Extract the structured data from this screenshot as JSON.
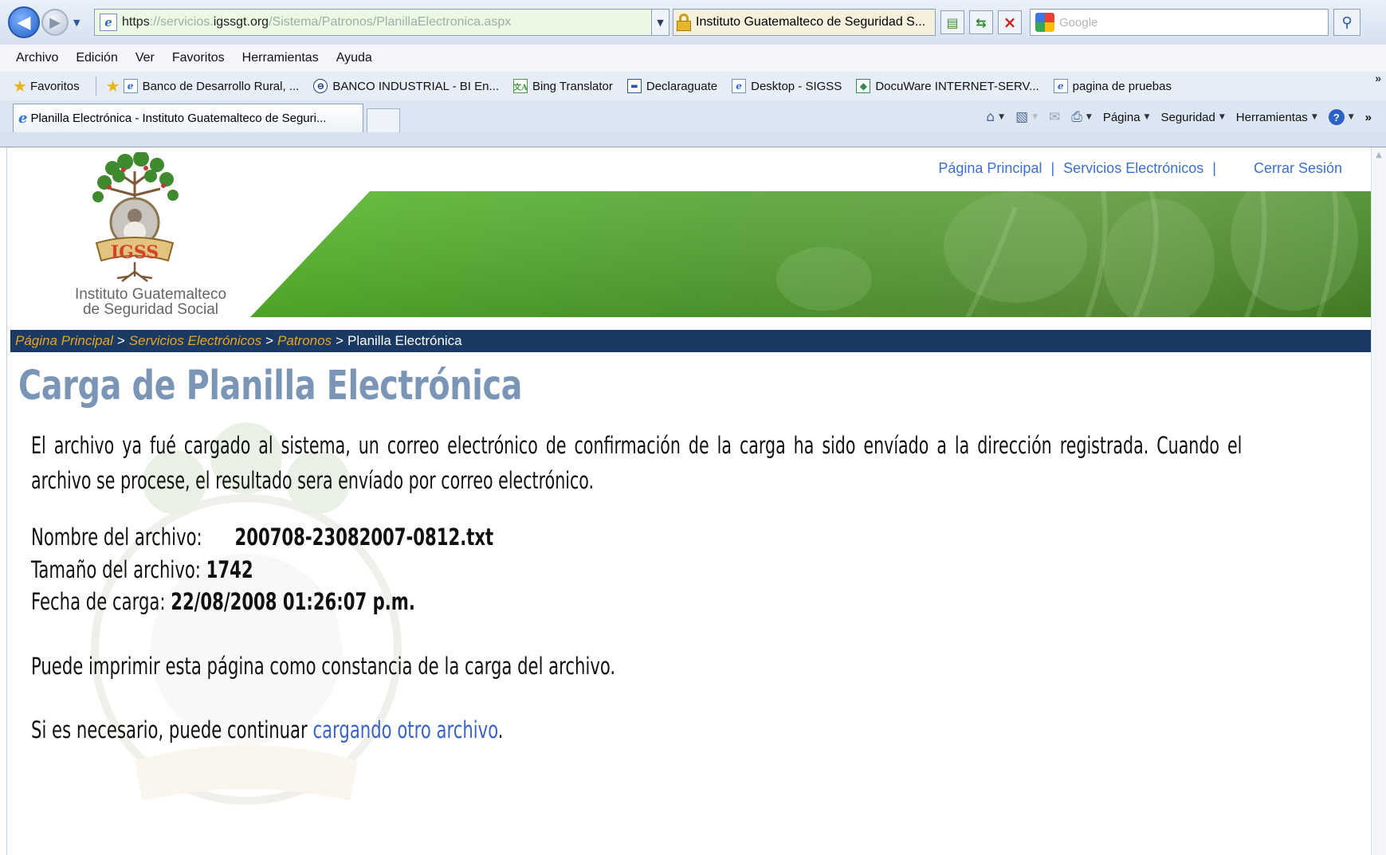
{
  "browser": {
    "url_scheme": "https",
    "url_subdomain": "://servicios.",
    "url_domain": "igssgt.org",
    "url_path": "/Sistema/Patronos/PlanillaElectronica.aspx",
    "site_identity": "Instituto Guatemalteco de Seguridad S...",
    "search_placeholder": "Google",
    "menu": [
      "Archivo",
      "Edición",
      "Ver",
      "Favoritos",
      "Herramientas",
      "Ayuda"
    ],
    "favorites_label": "Favoritos",
    "favorites": [
      {
        "label": "Banco de Desarrollo Rural, ...",
        "icon": "ie-page-icon"
      },
      {
        "label": "BANCO INDUSTRIAL - BI En...",
        "icon": "bi-logo-icon"
      },
      {
        "label": "Bing Translator",
        "icon": "translator-icon"
      },
      {
        "label": "Declaraguate",
        "icon": "declaraguate-icon"
      },
      {
        "label": "Desktop - SIGSS",
        "icon": "ie-page-icon"
      },
      {
        "label": "DocuWare INTERNET-SERV...",
        "icon": "docuware-icon"
      },
      {
        "label": "pagina de pruebas",
        "icon": "ie-page-icon"
      }
    ],
    "tab_title": "Planilla Electrónica - Instituto Guatemalteco de Seguri...",
    "command_bar": {
      "page": "Página",
      "security": "Seguridad",
      "tools": "Herramientas"
    }
  },
  "header": {
    "links": [
      "Página Principal",
      "Servicios Electrónicos",
      "Cerrar Sesión"
    ],
    "separator": "|",
    "logo_text_line1": "Instituto Guatemalteco",
    "logo_text_line2": "de Seguridad Social",
    "logo_word": "IGSS"
  },
  "breadcrumb": {
    "items": [
      "Página Principal",
      "Servicios Electrónicos",
      "Patronos"
    ],
    "current": "Planilla Electrónica",
    "separator": ">"
  },
  "main": {
    "title": "Carga de Planilla Electrónica",
    "message": "El archivo ya fué cargado al sistema, un correo electrónico de confirmación de la carga ha sido envíado a la dirección registrada. Cuando el archivo se procese, el resultado sera envíado por correo electrónico.",
    "file_name_label": "Nombre del archivo:",
    "file_name_value": "200708-23082007-0812.txt",
    "file_size_label": "Tamaño del archivo:",
    "file_size_value": "1742",
    "upload_date_label": "Fecha de carga:",
    "upload_date_value": "22/08/2008 01:26:07 p.m.",
    "print_note": "Puede imprimir esta página como constancia de la carga del archivo.",
    "continue_prefix": "Si es necesario, puede continuar",
    "continue_link": "cargando otro archivo",
    "continue_suffix": "."
  },
  "colors": {
    "breadcrumb_bg": "#1b3a63",
    "breadcrumb_link": "#e7a326",
    "title": "#7a95b6",
    "link": "#3b6fd1",
    "banner_green": "#5aa637"
  }
}
